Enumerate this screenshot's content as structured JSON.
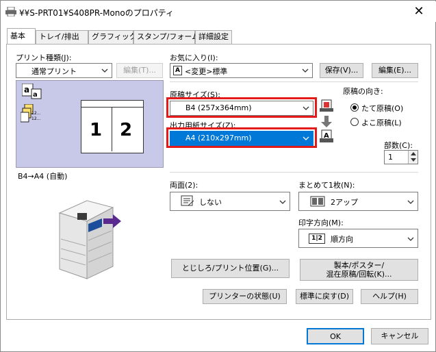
{
  "window": {
    "title": "¥¥S-PRT01¥S408PR-Monoのプロパティ",
    "close": "✕"
  },
  "tabs": [
    "基本",
    "トレイ/排出",
    "グラフィックス",
    "スタンプ/フォーム",
    "詳細設定"
  ],
  "print_type": {
    "label": "プリント種類(J):",
    "value": "通常プリント",
    "edit_button": "編集(T)..."
  },
  "favorites": {
    "label": "お気に入り(I):",
    "value": "<変更>標準",
    "badge": "A",
    "save_button": "保存(V)...",
    "edit_button": "編集(E)..."
  },
  "preview": {
    "page_numbers": [
      "1",
      "2"
    ],
    "mini_labels": [
      "12...",
      "12..."
    ],
    "caption": "B4→A4 (自動)"
  },
  "original_size": {
    "label": "原稿サイズ(S):",
    "value": "B4 (257x364mm)"
  },
  "output_size": {
    "label": "出力用紙サイズ(Z):",
    "value": "A4 (210x297mm)"
  },
  "orientation": {
    "label": "原稿の向き:",
    "options": [
      "たて原稿(O)",
      "よこ原稿(L)"
    ],
    "selected": 0
  },
  "copies": {
    "label": "部数(C):",
    "value": "1"
  },
  "duplex": {
    "label": "両面(2):",
    "value": "しない"
  },
  "nup": {
    "label": "まとめて1枚(N):",
    "value": "2アップ"
  },
  "print_order": {
    "label": "印字方向(M):",
    "value": "順方向",
    "icon_text": "1|2"
  },
  "buttons": {
    "binding": "とじしろ/プリント位置(G)...",
    "booklet_line1": "製本/ポスター/",
    "booklet_line2": "混在原稿/回転(K)...",
    "printer_status": "プリンターの状態(U)",
    "defaults": "標準に戻す(D)",
    "help": "ヘルプ(H)",
    "ok": "OK",
    "cancel": "キャンセル"
  },
  "colors": {
    "accent": "#0078d7",
    "highlight_frame": "#e21a1a",
    "preview_bg": "#c8c8e8"
  }
}
